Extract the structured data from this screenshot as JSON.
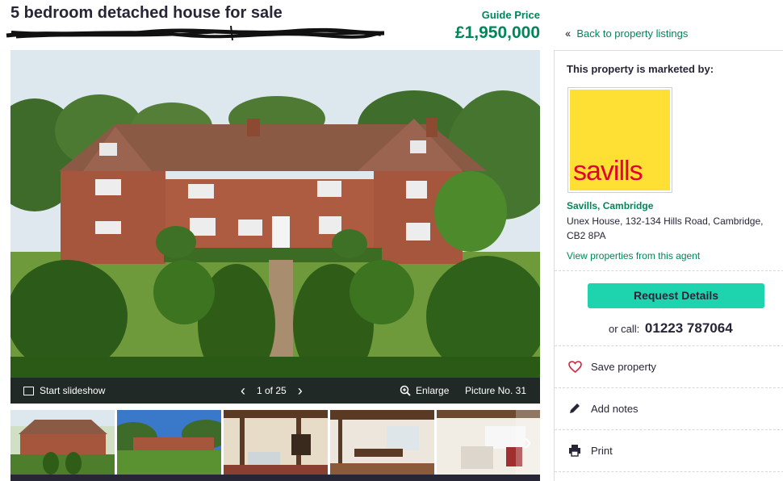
{
  "listing": {
    "title": "5 bedroom detached house for sale",
    "price_label": "Guide Price",
    "price": "£1,950,000"
  },
  "nav": {
    "back_label": "Back to property listings"
  },
  "gallery": {
    "slideshow_label": "Start slideshow",
    "counter": "1 of 25",
    "enlarge_label": "Enlarge",
    "picture_label": "Picture No. 31",
    "prev_icon": "chevron-left-icon",
    "next_icon": "chevron-right-icon"
  },
  "agent": {
    "heading": "This property is marketed by:",
    "logo_text": "savills",
    "brand_colors": {
      "yellow": "#fde033",
      "red": "#e4032e"
    },
    "name": "Savills, Cambridge",
    "address": "Unex House, 132-134 Hills Road, Cambridge, CB2 8PA",
    "view_link": "View properties from this agent",
    "request_button": "Request Details",
    "call_prefix": "or call:",
    "phone": "01223 787064"
  },
  "actions": [
    {
      "label": "Save property",
      "icon": "heart-icon"
    },
    {
      "label": "Add notes",
      "icon": "pencil-icon"
    },
    {
      "label": "Print",
      "icon": "printer-icon"
    }
  ],
  "colors": {
    "accent": "#00865a",
    "button": "#1ed4ae",
    "text": "#262637"
  }
}
